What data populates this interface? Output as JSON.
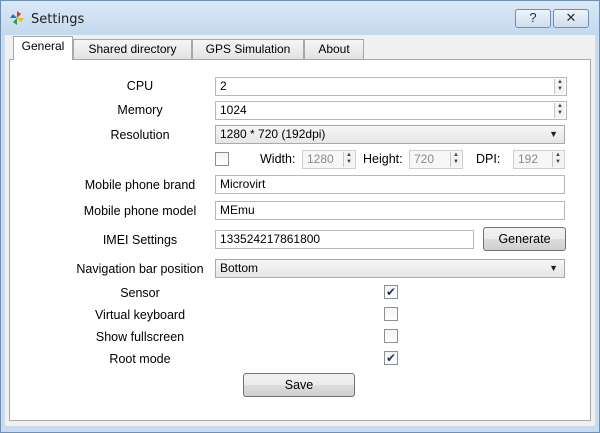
{
  "window": {
    "title": "Settings",
    "help_label": "?",
    "close_label": "✕"
  },
  "tabs": [
    {
      "label": "General"
    },
    {
      "label": "Shared directory"
    },
    {
      "label": "GPS Simulation"
    },
    {
      "label": "About"
    }
  ],
  "cpu": {
    "label": "CPU",
    "value": "2"
  },
  "memory": {
    "label": "Memory",
    "value": "1024"
  },
  "resolution": {
    "label": "Resolution",
    "value": "1280 * 720 (192dpi)",
    "custom_checked": false,
    "width_label": "Width:",
    "width_value": "1280",
    "height_label": "Height:",
    "height_value": "720",
    "dpi_label": "DPI:",
    "dpi_value": "192"
  },
  "brand": {
    "label": "Mobile phone brand",
    "value": "Microvirt"
  },
  "model": {
    "label": "Mobile phone model",
    "value": "MEmu"
  },
  "imei": {
    "label": "IMEI Settings",
    "value": "133524217861800",
    "generate_label": "Generate"
  },
  "navbar": {
    "label": "Navigation bar position",
    "value": "Bottom"
  },
  "sensor": {
    "label": "Sensor",
    "checked": true
  },
  "virtual_keyboard": {
    "label": "Virtual keyboard",
    "checked": false
  },
  "fullscreen": {
    "label": "Show fullscreen",
    "checked": false
  },
  "root_mode": {
    "label": "Root mode",
    "checked": true
  },
  "save_label": "Save",
  "icons": {
    "app": "pinwheel-icon",
    "combo_arrow": "chevron-down-icon",
    "check": "checkmark-icon"
  }
}
